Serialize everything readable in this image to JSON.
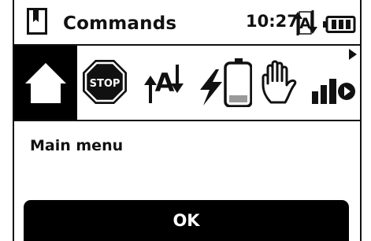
{
  "header": {
    "title": "Commands",
    "time": "10:27",
    "icons": [
      "book-icon",
      "auto-mode-icon",
      "battery-icon"
    ]
  },
  "commands": [
    {
      "name": "home-icon",
      "selected": true
    },
    {
      "name": "stop-icon",
      "label": "STOP"
    },
    {
      "name": "auto-mode-icon",
      "label": "A"
    },
    {
      "name": "charge-icon"
    },
    {
      "name": "hand-icon"
    },
    {
      "name": "park-icon"
    }
  ],
  "more_indicator": "right-arrow-icon",
  "menu": {
    "label": "Main menu"
  },
  "ok_button": {
    "label": "OK"
  },
  "colors": {
    "foreground": "#111111",
    "background": "#ffffff",
    "accent": "#000000"
  }
}
